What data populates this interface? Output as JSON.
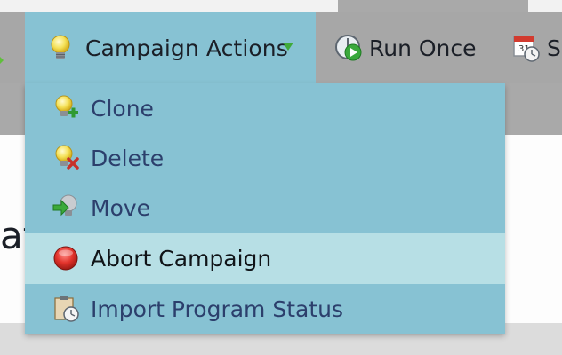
{
  "toolbar": {
    "campaign_actions_label": "Campaign Actions",
    "run_once_label": "Run Once",
    "schedule_label_fragment": "Sc"
  },
  "menu": {
    "items": [
      {
        "label": "Clone",
        "icon": "clone-icon"
      },
      {
        "label": "Delete",
        "icon": "delete-icon"
      },
      {
        "label": "Move",
        "icon": "move-icon"
      },
      {
        "label": "Abort Campaign",
        "icon": "abort-icon",
        "highlighted": true
      },
      {
        "label": "Import Program Status",
        "icon": "import-status-icon"
      }
    ]
  },
  "background": {
    "content_fragment": "at"
  },
  "colors": {
    "menu_bg": "#87c2d3",
    "menu_hover": "#b7dfe5",
    "toolbar_bg": "#a7a7a7",
    "menu_text": "#2c3f6c"
  }
}
